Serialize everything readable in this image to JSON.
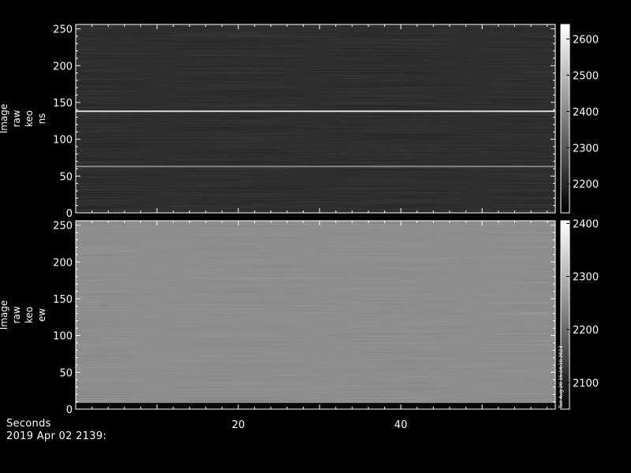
{
  "footer": {
    "xlabel": "Seconds",
    "time_label": "2019 Apr 02 2139:"
  },
  "side_note": "Tue Aug 20 15:24:10 2023",
  "chart_data": [
    {
      "type": "heatmap",
      "ylabel_lines": [
        "Image",
        "raw",
        "keo",
        "ns"
      ],
      "xlim": [
        0,
        59
      ],
      "ylim": [
        0,
        256
      ],
      "yticks": [
        0,
        50,
        100,
        150,
        200,
        250
      ],
      "colorbar": {
        "range": [
          2120,
          2640
        ],
        "ticks": [
          2200,
          2300,
          2400,
          2500,
          2600
        ]
      },
      "colormap": "grayscale",
      "base_level": 2190,
      "bright_rows": [
        {
          "y": 138,
          "value": 2620
        },
        {
          "y": 63,
          "value": 2420
        }
      ]
    },
    {
      "type": "heatmap",
      "ylabel_lines": [
        "Image",
        "raw",
        "keo",
        "ew"
      ],
      "xlim": [
        0,
        59
      ],
      "ylim": [
        0,
        256
      ],
      "yticks": [
        0,
        50,
        100,
        150,
        200,
        250
      ],
      "colorbar": {
        "range": [
          2050,
          2405
        ],
        "ticks": [
          2100,
          2200,
          2300,
          2400
        ]
      },
      "colormap": "grayscale",
      "base_level": 2240,
      "dark_rows": [
        {
          "y": 2,
          "value": 2060
        }
      ]
    }
  ],
  "x_axis": {
    "ticks": [
      20,
      40
    ]
  }
}
